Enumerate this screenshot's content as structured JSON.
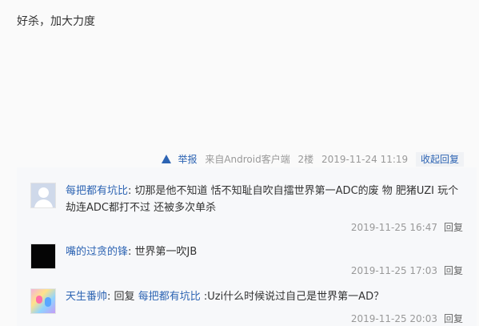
{
  "post": {
    "content": "好杀，加大力度"
  },
  "tail": {
    "report_label": "举报",
    "source": "来自Android客户端",
    "floor": "2楼",
    "time": "2019-11-24 11:19",
    "collapse_label": "收起回复"
  },
  "replies": [
    {
      "user": "每把都有坑比",
      "text": "切那是他不知道 恬不知耻自吹自擂世界第一ADC的废 物 肥猪UZI 玩个劫连ADC都打不过 还被多次单杀",
      "time": "2019-11-25 16:47",
      "reply_label": "回复",
      "avatar_icon": "default-avatar"
    },
    {
      "user": "嘴的过贪的锋",
      "text": "世界第一吹JB",
      "time": "2019-11-25 17:03",
      "reply_label": "回复",
      "avatar_icon": "dark-avatar"
    },
    {
      "user": "天生番帅",
      "reply_prefix": "回复",
      "reply_to": "每把都有坑比",
      "text": ":Uzi什么时候说过自己是世界第一AD？",
      "time": "2019-11-25 20:03",
      "reply_label": "回复",
      "avatar_icon": "colorful-avatar"
    }
  ]
}
